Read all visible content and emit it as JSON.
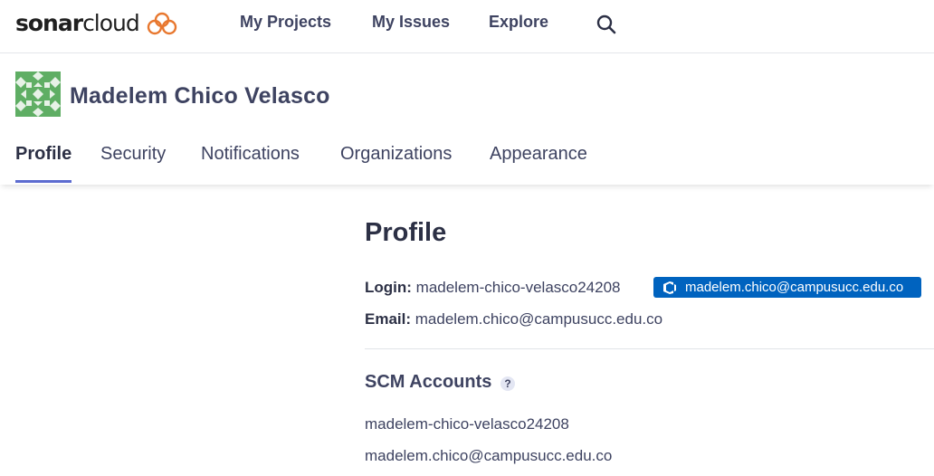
{
  "brand": {
    "name_bold": "sonar",
    "name_light": "cloud"
  },
  "topnav": {
    "items": [
      {
        "label": "My Projects"
      },
      {
        "label": "My Issues"
      },
      {
        "label": "Explore"
      }
    ],
    "search_icon": "search-icon"
  },
  "user": {
    "name": "Madelem Chico Velasco",
    "avatar_icon": "identicon-avatar"
  },
  "tabs": [
    {
      "label": "Profile",
      "active": true
    },
    {
      "label": "Security"
    },
    {
      "label": "Notifications"
    },
    {
      "label": "Organizations"
    },
    {
      "label": "Appearance"
    }
  ],
  "profile": {
    "title": "Profile",
    "login_label": "Login:",
    "login_value": "madelem-chico-velasco24208",
    "badge": {
      "icon": "azure-devops-icon",
      "text": "madelem.chico@campusucc.edu.co"
    },
    "email_label": "Email:",
    "email_value": "madelem.chico@campusucc.edu.co",
    "scm_title": "SCM Accounts",
    "scm_help": "?",
    "scm_accounts": [
      "madelem-chico-velasco24208",
      "madelem.chico@campusucc.edu.co"
    ]
  },
  "colors": {
    "accent": "#5d6cd0",
    "badge": "#0063bf",
    "brand_orange": "#e8772e",
    "avatar_green": "#5fae64"
  }
}
